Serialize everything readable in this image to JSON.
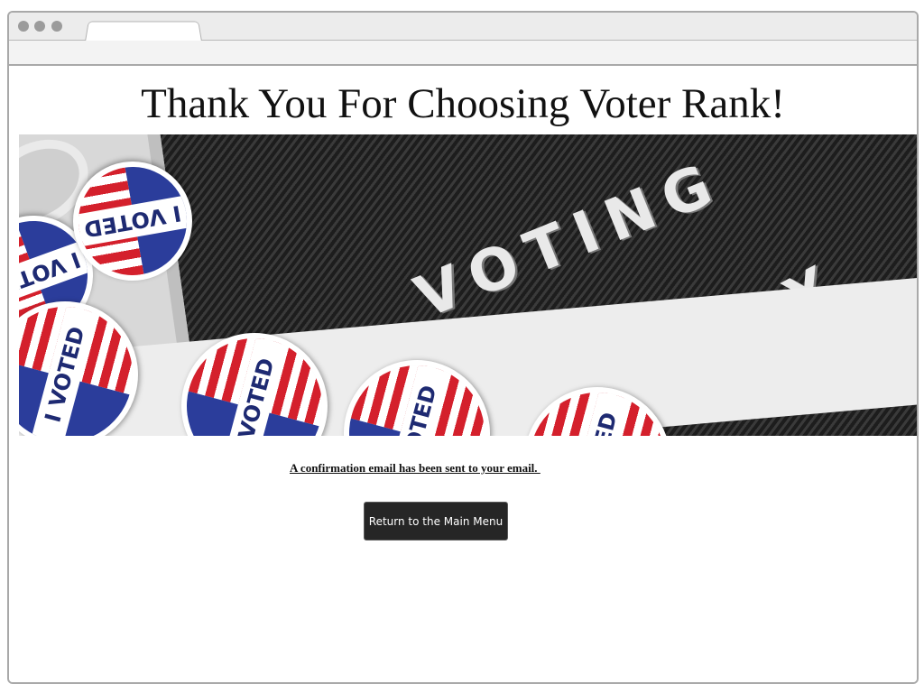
{
  "page": {
    "title": "Thank You For Choosing Voter Rank!",
    "confirmation_message": "A confirmation email has been sent to your email. ",
    "return_button_label": "Return to the Main Menu"
  },
  "hero_image": {
    "board_word_1": "VOTING",
    "board_word_2": "DAY",
    "sticker_label": "I VOTED"
  },
  "colors": {
    "button_bg": "#262626",
    "sticker_blue": "#2b3d9b",
    "sticker_red": "#d4202c"
  }
}
